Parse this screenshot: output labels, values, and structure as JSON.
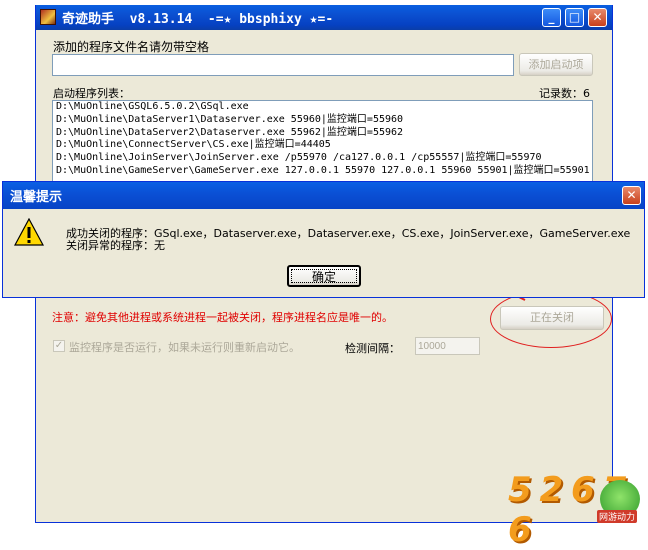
{
  "window": {
    "title": "奇迹助手  v8.13.14  -=★ bbsphixy ★=-",
    "minimize_glyph": "_",
    "maximize_glyph": "□",
    "close_glyph": "✕"
  },
  "program_input": {
    "label": "添加的程序文件名请勿带空格",
    "value": "",
    "add_button": "添加启动项"
  },
  "program_list": {
    "label": "启动程序列表：",
    "count_label": "记录数：6",
    "items": [
      "D:\\MuOnline\\GSQL6.5.0.2\\GSql.exe",
      "D:\\MuOnline\\DataServer1\\Dataserver.exe 55960|监控端口=55960",
      "D:\\MuOnline\\DataServer2\\Dataserver.exe 55962|监控端口=55962",
      "D:\\MuOnline\\ConnectServer\\CS.exe|监控端口=44405",
      "D:\\MuOnline\\JoinServer\\JoinServer.exe /p55970 /ca127.0.0.1 /cp55557|监控端口=55970",
      "D:\\MuOnline\\GameServer\\GameServer.exe 127.0.0.1 55970 127.0.0.1 55960 55901|监控端口=55901"
    ]
  },
  "note": "注意：避免其他进程或系统进程一起被关闭，程序进程名应是唯一的。",
  "closing_button": "正在关闭",
  "monitor": {
    "checkbox_label": "监控程序是否运行，如果未运行则重新启动它。",
    "interval_label": "检测间隔：",
    "interval_value": "10000"
  },
  "dialog": {
    "title": "温馨提示",
    "line1": "成功关闭的程序：GSql.exe，Dataserver.exe，Dataserver.exe，CS.exe，JoinServer.exe，GameServer.exe",
    "line2": "关闭异常的程序：无",
    "ok_button": "确定",
    "icon": "warning-icon"
  },
  "watermark": {
    "digits": "5 2 6 7 6",
    "tag": "网游动力"
  },
  "colors": {
    "title_blue": "#0a4fd0",
    "note_red": "#e00000",
    "annotation_red": "#e02020"
  }
}
